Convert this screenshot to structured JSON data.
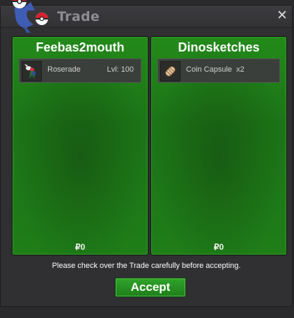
{
  "window": {
    "title": "Trade",
    "close_icon": "close-icon"
  },
  "left": {
    "name": "Feebas2mouth",
    "item": {
      "icon": "roserade-sprite-icon",
      "name": "Roserade",
      "level": "Lvl: 100"
    },
    "money": "₽0"
  },
  "right": {
    "name": "Dinosketches",
    "item": {
      "icon": "coin-capsule-icon",
      "name": "Coin Capsule  x2"
    },
    "money": "₽0"
  },
  "notice": "Please check over the Trade carefully before accepting.",
  "accept_label": "Accept",
  "colors": {
    "panel_green": "#1f7e18",
    "button_green": "#2fa32a"
  }
}
